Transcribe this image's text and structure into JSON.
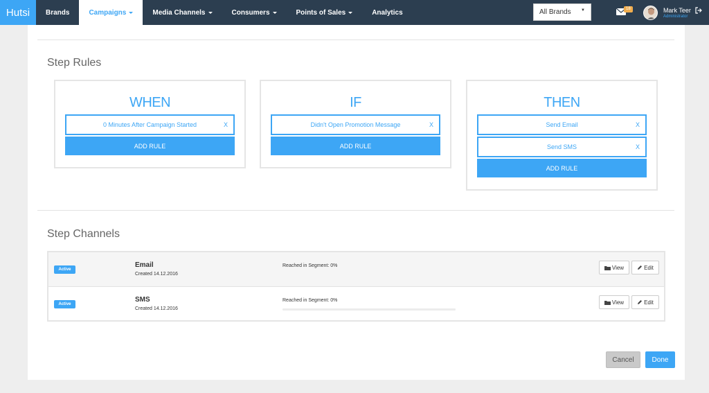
{
  "app": {
    "name": "Hutsi"
  },
  "nav": {
    "items": [
      {
        "label": "Brands",
        "dropdown": false,
        "active": false
      },
      {
        "label": "Campaigns",
        "dropdown": true,
        "active": true
      },
      {
        "label": "Media Channels",
        "dropdown": true,
        "active": false
      },
      {
        "label": "Consumers",
        "dropdown": true,
        "active": false
      },
      {
        "label": "Points of Sales",
        "dropdown": true,
        "active": false
      },
      {
        "label": "Analytics",
        "dropdown": false,
        "active": false
      }
    ]
  },
  "header": {
    "brand_filter": "All Brands",
    "notification_count": "18",
    "user_name": "Mark Teer",
    "user_role": "Administrator"
  },
  "step_rules": {
    "title": "Step Rules",
    "when": {
      "heading": "WHEN",
      "items": [
        "0 Minutes After Campaign Started"
      ],
      "remove_label": "X",
      "add_label": "ADD RULE"
    },
    "if": {
      "heading": "IF",
      "items": [
        "Didn't Open Promotion Message"
      ],
      "remove_label": "X",
      "add_label": "ADD RULE"
    },
    "then": {
      "heading": "THEN",
      "items": [
        "Send Email",
        "Send SMS"
      ],
      "remove_label": "X",
      "add_label": "ADD RULE"
    }
  },
  "step_channels": {
    "title": "Step Channels",
    "rows": [
      {
        "status": "Active",
        "name": "Email",
        "created": "Created 14.12.2016",
        "reached": "Reached in Segment: 0%",
        "progress": 0,
        "view_label": "View",
        "edit_label": "Edit"
      },
      {
        "status": "Active",
        "name": "SMS",
        "created": "Created 14.12.2016",
        "reached": "Reached in Segment: 0%",
        "progress": 0,
        "view_label": "View",
        "edit_label": "Edit"
      }
    ]
  },
  "actions": {
    "cancel": "Cancel",
    "done": "Done"
  },
  "colors": {
    "accent": "#3da6f5",
    "navbar": "#2c3e50",
    "badge": "#f0ad4e"
  }
}
